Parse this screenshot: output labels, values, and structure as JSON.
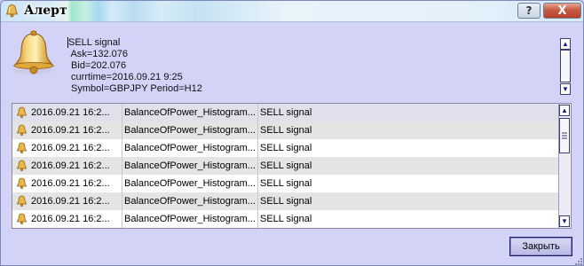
{
  "window": {
    "title": "Алерт",
    "help_glyph": "?",
    "close_glyph": "X",
    "app_icon": "bell-icon"
  },
  "message": {
    "icon": "bell-icon",
    "lines": [
      "SELL signal",
      " Ask=132.076",
      " Bid=202.076",
      " currtime=2016.09.21 9:25",
      " Symbol=GBPJPY Period=H12"
    ]
  },
  "list": {
    "rows": [
      {
        "time": "2016.09.21 16:2...",
        "indicator": "BalanceOfPower_Histogram...",
        "signal": "SELL signal"
      },
      {
        "time": "2016.09.21 16:2...",
        "indicator": "BalanceOfPower_Histogram...",
        "signal": "SELL signal"
      },
      {
        "time": "2016.09.21 16:2...",
        "indicator": "BalanceOfPower_Histogram...",
        "signal": "SELL signal"
      },
      {
        "time": "2016.09.21 16:2...",
        "indicator": "BalanceOfPower_Histogram...",
        "signal": "SELL signal"
      },
      {
        "time": "2016.09.21 16:2...",
        "indicator": "BalanceOfPower_Histogram...",
        "signal": "SELL signal"
      },
      {
        "time": "2016.09.21 16:2...",
        "indicator": "BalanceOfPower_Histogram...",
        "signal": "SELL signal"
      },
      {
        "time": "2016.09.21 16:2...",
        "indicator": "BalanceOfPower_Histogram...",
        "signal": "SELL signal"
      }
    ]
  },
  "footer": {
    "close_label": "Закрыть"
  },
  "colors": {
    "window_bg": "#d2d3f6",
    "list_alt_row": "#e4e4e4",
    "button_border": "#1c1c6e"
  }
}
